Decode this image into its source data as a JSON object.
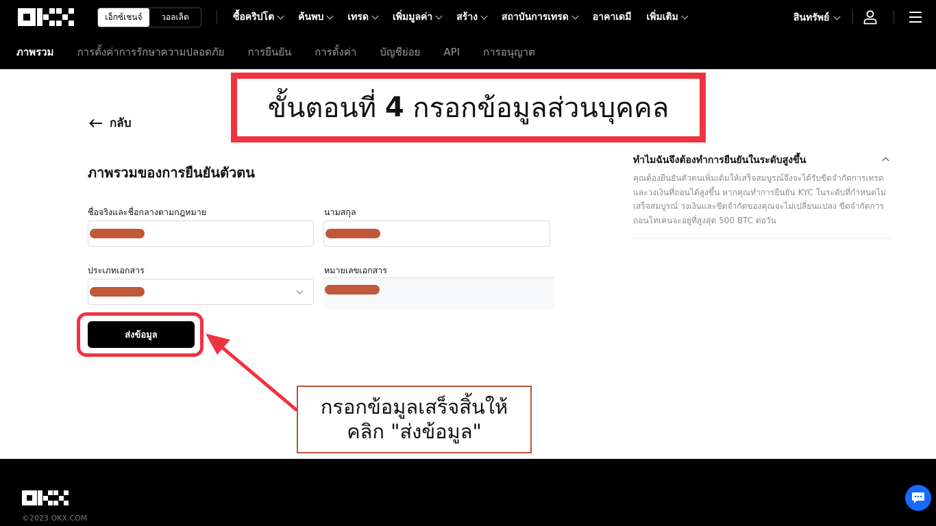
{
  "topnav": {
    "toggle": [
      "เอ็กซ์เชนจ์",
      "วอลเล็ต"
    ],
    "menu": [
      "ซื้อคริปโต",
      "ค้นพบ",
      "เทรด",
      "เพิ่มมูลค่า",
      "สร้าง",
      "สถาบันการเทรด",
      "อาคาเดมี",
      "เพิ่มเติม"
    ],
    "assets": "สินทรัพย์"
  },
  "subnav": [
    "ภาพรวม",
    "การตั้งค่าการรักษาความปลอดภัย",
    "การยืนยัน",
    "การตั้งค่า",
    "บัญชีย่อย",
    "API",
    "การอนุญาต"
  ],
  "back_label": "กลับ",
  "step_banner": {
    "prefix": "ขั้นตอนที่ ",
    "number": "4",
    "suffix": " กรอกข้อมูลส่วนบุคคล"
  },
  "form": {
    "title": "ภาพรวมของการยืนยันตัวตน",
    "first_name_label": "ชื่อจริงและชื่อกลางตามกฎหมาย",
    "last_name_label": "นามสกุล",
    "doc_type_label": "ประเภทเอกสาร",
    "doc_number_label": "หมายเลขเอกสาร",
    "submit_label": "ส่งข้อมูล"
  },
  "callout": {
    "line1": "กรอกข้อมูลเสร็จสิ้นให้",
    "line2": "คลิก \"ส่งข้อมูล\""
  },
  "faq": {
    "question": "ทำไมฉันจึงต้องทำการยืนยันในระดับสูงขึ้น",
    "answer": "คุณต้องยืนยันตัวตนเพิ่มเติมให้เสร็จสมบูรณ์จึงจะได้รับขีดจำกัดการเทรดและวงเงินที่ถอนได้สูงขึ้น หากคุณทำการยืนยัน KYC ในระดับที่กำหนดไม่เสร็จสมบูรณ์ วงเงินและขีดจำกัดของคุณจะไม่เปลี่ยนแปลง ขีดจำกัดการถอนโทเคนจะอยู่ที่สูงสุด 500 BTC ต่อวัน"
  },
  "footer": {
    "copyright": "©2023 OKX.COM"
  },
  "colors": {
    "annotation_red": "#ef3340",
    "redaction": "#c0583a",
    "callout_border": "#b5533a",
    "chat_blue": "#1769ff"
  }
}
